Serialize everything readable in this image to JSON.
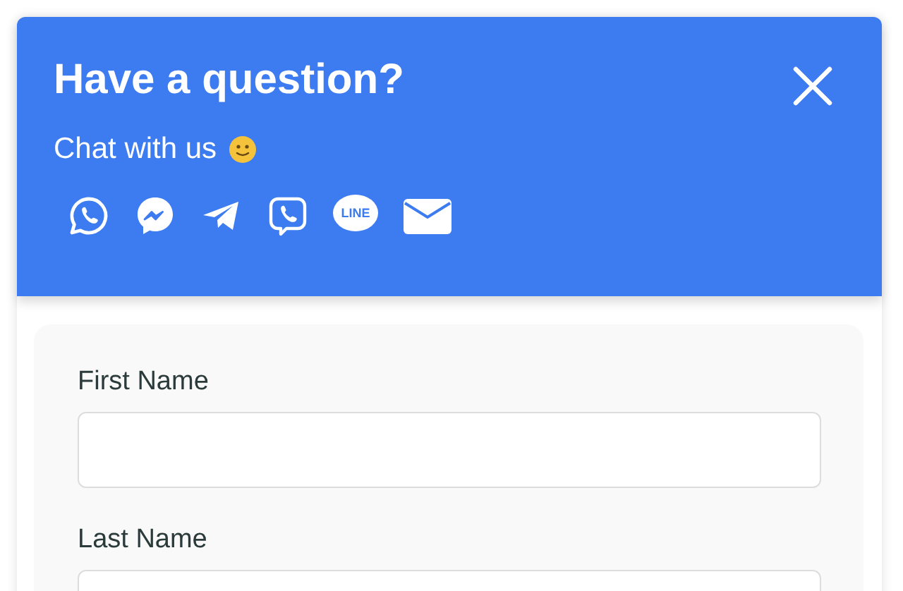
{
  "header": {
    "title": "Have a question?",
    "subtitle": "Chat with us"
  },
  "channels": [
    {
      "kind": "whatsapp"
    },
    {
      "kind": "messenger"
    },
    {
      "kind": "telegram"
    },
    {
      "kind": "viber"
    },
    {
      "kind": "line",
      "label": "LINE"
    },
    {
      "kind": "email"
    }
  ],
  "fields": [
    {
      "label": "First Name"
    },
    {
      "label": "Last Name"
    }
  ]
}
